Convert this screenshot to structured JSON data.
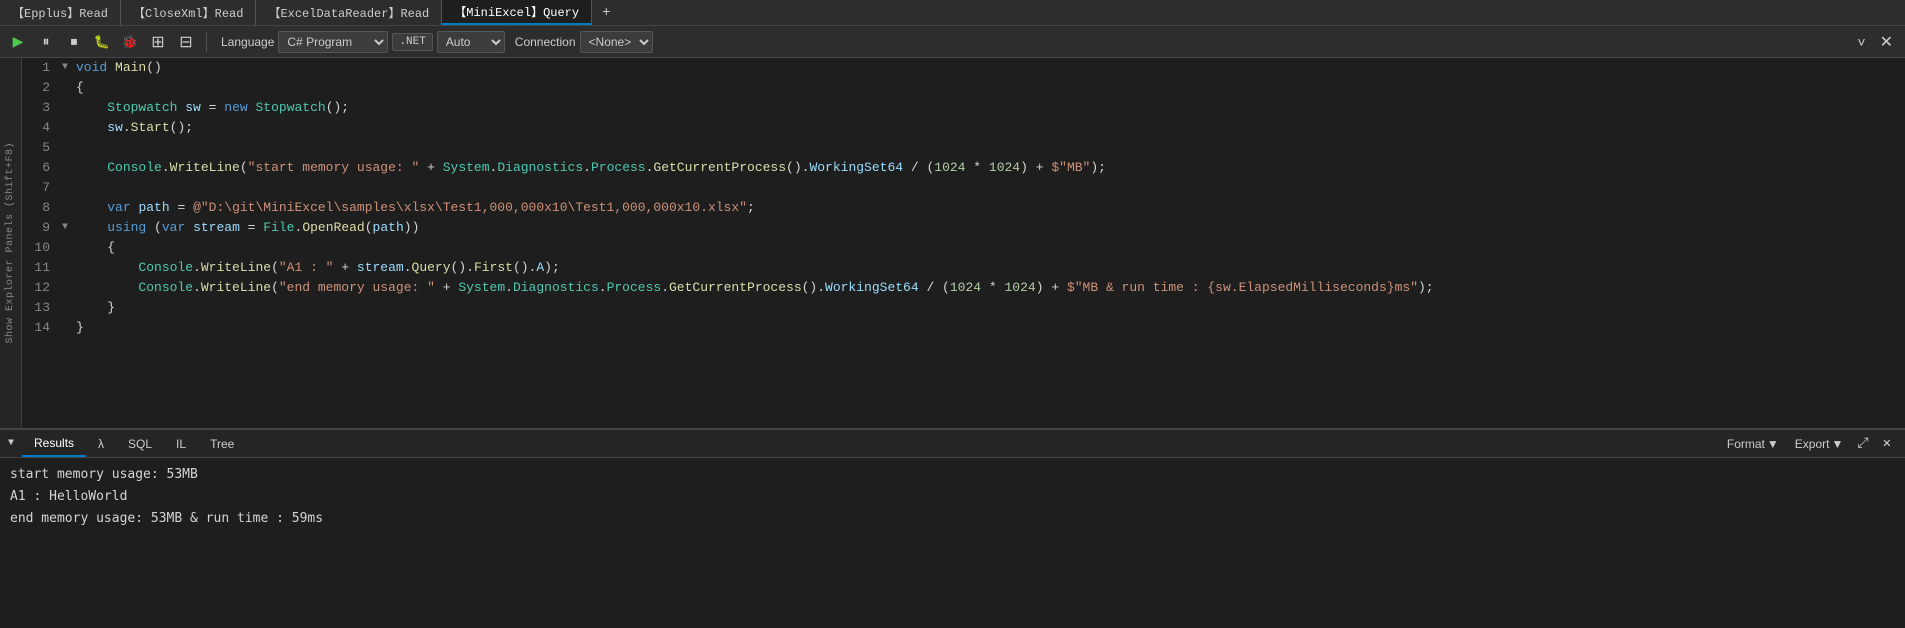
{
  "tabs": [
    {
      "id": "epplus",
      "label": "【Epplus】Read"
    },
    {
      "id": "closexml",
      "label": "【CloseXml】Read"
    },
    {
      "id": "exceldatareader",
      "label": "【ExcelDataReader】Read"
    },
    {
      "id": "miniexcel",
      "label": "【MiniExcel】Query",
      "active": true
    },
    {
      "id": "add",
      "label": "+"
    }
  ],
  "toolbar": {
    "play_label": "▶",
    "pause_label": "⏸",
    "stop_label": "⏹",
    "debug1_label": "🐛",
    "debug2_label": "🐛",
    "grid1_label": "⊞",
    "grid2_label": "⊟",
    "language_label": "Language",
    "language_value": "C# Program",
    "dotnet_label": ".NET",
    "auto_label": "Auto",
    "connection_label": "Connection",
    "connection_value": "<None>",
    "chevron_label": "˅",
    "close_label": "✕"
  },
  "code_lines": [
    {
      "num": 1,
      "has_collapse": true,
      "content": "void_main_open"
    },
    {
      "num": 2,
      "content": "brace_open"
    },
    {
      "num": 3,
      "content": "stopwatch_line"
    },
    {
      "num": 4,
      "content": "sw_start_line"
    },
    {
      "num": 5,
      "content": "blank"
    },
    {
      "num": 6,
      "content": "blank"
    },
    {
      "num": 7,
      "content": "var_path_line"
    },
    {
      "num": 8,
      "has_collapse": true,
      "content": "using_line"
    },
    {
      "num": 9,
      "content": "brace_open_indent"
    },
    {
      "num": 10,
      "content": "console_a1_line"
    },
    {
      "num": 11,
      "content": "console_end_line"
    },
    {
      "num": 12,
      "content": "brace_close_indent"
    },
    {
      "num": 13,
      "content": "brace_close"
    },
    {
      "num": 14,
      "content": "blank"
    }
  ],
  "bottom_panel": {
    "tabs": [
      {
        "id": "results",
        "label": "Results",
        "active": true
      },
      {
        "id": "lambda",
        "label": "λ"
      },
      {
        "id": "sql",
        "label": "SQL"
      },
      {
        "id": "il",
        "label": "IL"
      },
      {
        "id": "tree",
        "label": "Tree"
      }
    ],
    "format_label": "Format",
    "export_label": "Export",
    "expand_label": "⤢",
    "close_label": "✕",
    "output": [
      "start memory usage: 53MB",
      "A1 : HelloWorld",
      "end memory usage: 53MB & run time : 59ms"
    ]
  },
  "left_sidebar": {
    "label": "Show Explorer Panels (Shift+F8)"
  }
}
